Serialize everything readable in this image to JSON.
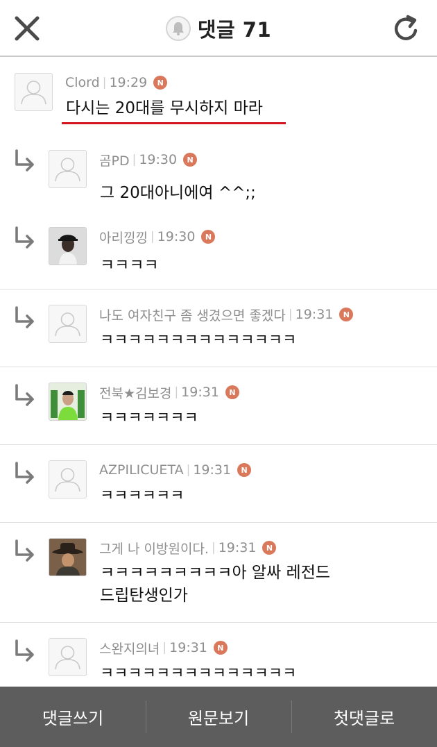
{
  "header": {
    "title": "댓글 71",
    "close_icon": "close-icon",
    "bell_icon": "bell-icon",
    "refresh_icon": "refresh-icon"
  },
  "badge_label": "N",
  "comments": [
    {
      "author": "Clord",
      "time": "19:29",
      "text": "다시는 20대를 무시하지 마라",
      "reply": false,
      "avatar": "default",
      "highlight": true
    },
    {
      "author": "곰PD",
      "time": "19:30",
      "text": "그 20대아니에여 ^^;;",
      "reply": true,
      "avatar": "default"
    },
    {
      "author": "아리낑낑",
      "time": "19:30",
      "text": "ㅋㅋㅋㅋ",
      "reply": true,
      "avatar": "photo-cap"
    },
    {
      "author": "나도 여자친구 좀 생겼으면 좋겠다",
      "time": "19:31",
      "text": "ㅋㅋㅋㅋㅋㅋㅋㅋㅋㅋㅋㅋㅋㅋ",
      "reply": true,
      "avatar": "default"
    },
    {
      "author": "전북★김보경",
      "time": "19:31",
      "text": "ㅋㅋㅋㅋㅋㅋㅋ",
      "reply": true,
      "avatar": "photo-jersey"
    },
    {
      "author": "AZPILICUETA",
      "time": "19:31",
      "text": "ㅋㅋㅋㅋㅋㅋ",
      "reply": true,
      "avatar": "default"
    },
    {
      "author": "그게 나 이방원이다.",
      "time": "19:31",
      "text": "ㅋㅋㅋㅋㅋㅋㅋㅋㅋ아 알싸 레전드",
      "text2": "드립탄생인가",
      "reply": true,
      "avatar": "photo-hat"
    },
    {
      "author": "스완지의녀",
      "time": "19:31",
      "text": "ㅋㅋㅋㅋㅋㅋㅋㅋㅋㅋㅋㅋㅋㅋ",
      "reply": true,
      "avatar": "default"
    }
  ],
  "bottom_bar": {
    "write": "댓글쓰기",
    "original": "원문보기",
    "first": "첫댓글로"
  },
  "colors": {
    "badge": "#d9785a",
    "underline": "#d4151f",
    "bottom_bar": "#5d5d5d"
  }
}
